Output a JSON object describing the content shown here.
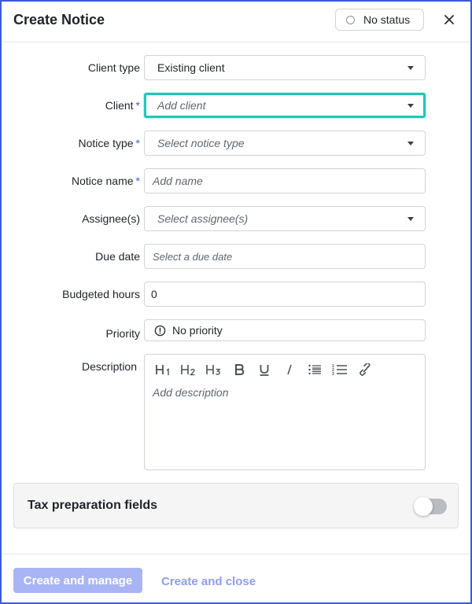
{
  "header": {
    "title": "Create Notice",
    "status_label": "No status"
  },
  "form": {
    "client_type": {
      "label": "Client type",
      "value": "Existing client"
    },
    "client": {
      "label": "Client",
      "required": "*",
      "placeholder": "Add client"
    },
    "notice_type": {
      "label": "Notice type",
      "required": "*",
      "placeholder": "Select notice type"
    },
    "notice_name": {
      "label": "Notice name",
      "required": "*",
      "placeholder": "Add name"
    },
    "assignees": {
      "label": "Assignee(s)",
      "placeholder": "Select assignee(s)"
    },
    "due_date": {
      "label": "Due date",
      "placeholder": "Select a due date"
    },
    "budgeted_hours": {
      "label": "Budgeted hours",
      "value": "0"
    },
    "priority": {
      "label": "Priority",
      "value": "No priority"
    },
    "description": {
      "label": "Description",
      "placeholder": "Add description",
      "toolbar": [
        "heading-1",
        "heading-2",
        "heading-3",
        "bold",
        "underline",
        "italic",
        "bullet-list",
        "numbered-list",
        "link"
      ]
    }
  },
  "tax_section": {
    "title": "Tax preparation fields",
    "toggle_on": false
  },
  "footer": {
    "primary_label": "Create and manage",
    "secondary_label": "Create and close"
  },
  "colors": {
    "border_accent": "#3b5bdb",
    "focus": "#20c7b7",
    "required": "#3b5bdb",
    "primary_disabled": "#a9b4f5",
    "link_disabled": "#8e9cf0"
  }
}
